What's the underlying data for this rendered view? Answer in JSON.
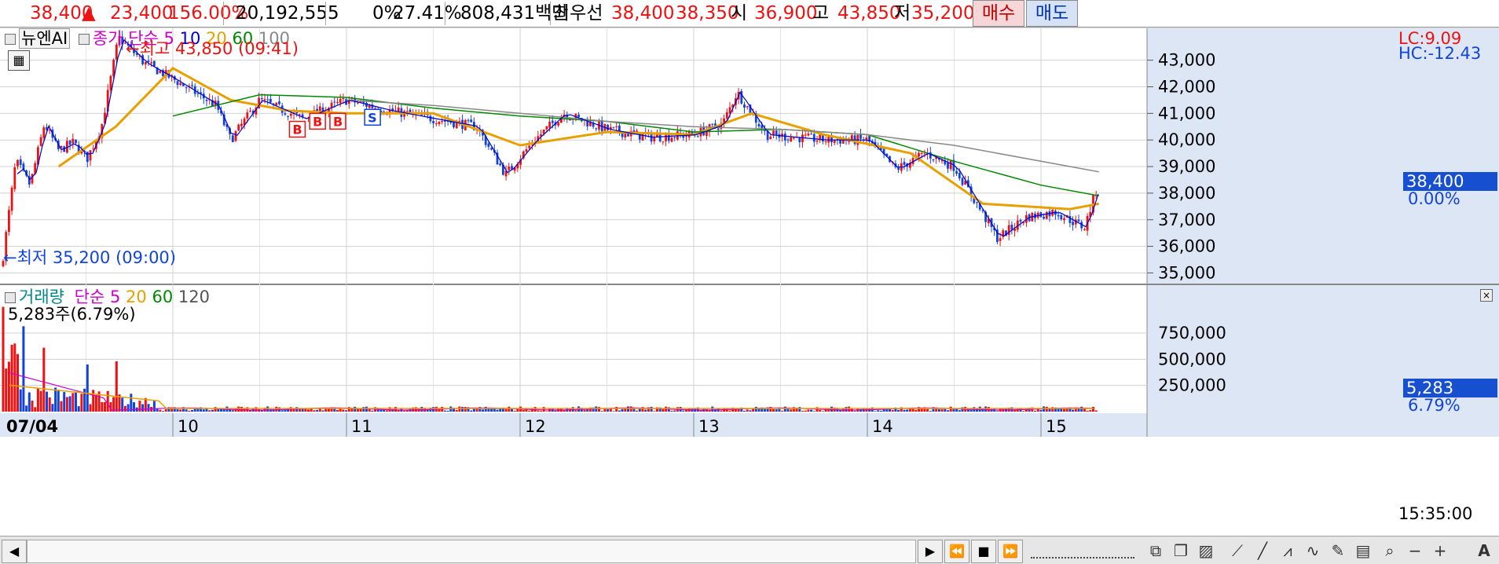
{
  "quote": {
    "price": "38,400",
    "up_arrow": "▲",
    "change": "23,400",
    "change_pct": "156.00%",
    "volume": "20,192,555",
    "zero_pct": "0%",
    "ratio": "27.41%",
    "amount": "808,431백만",
    "best_label": "최우선",
    "best_ask": "38,400",
    "best_bid": "38,350",
    "open_label": "시",
    "open": "36,900",
    "high_label": "고",
    "high": "43,850",
    "low_label": "저",
    "low": "35,200",
    "buy_label": "매수",
    "sell_label": "매도"
  },
  "colors": {
    "up": "#ee1111",
    "down": "#1144dd",
    "ma5": "#0000cc",
    "ma20": "#e8a000",
    "ma60": "#008800",
    "ma100": "#888888",
    "buy_bg": "#f6d6d6",
    "sell_bg": "#d6e2f6",
    "axis_bg": "#dde6f4",
    "grid": "#d0d0d0"
  },
  "price_panel": {
    "stock_name": "뉴엔AI",
    "ma_label": "종가 단순",
    "ma_periods": [
      "5",
      "10",
      "20",
      "60",
      "100"
    ],
    "lc": "LC:9.09",
    "hc": "HC:-12.43",
    "high_note": "최고 43,850 (09:41)",
    "low_note": "최저 35,200 (09:00)",
    "current_price": "38,400",
    "current_pct": "0.00%",
    "signals": [
      "B",
      "B",
      "B",
      "S"
    ]
  },
  "volume_panel": {
    "label": "거래량",
    "ma_label": "단순",
    "ma_periods": [
      "5",
      "20",
      "60",
      "120"
    ],
    "info": "5,283주(6.79%)",
    "current": "5,283",
    "current_pct": "6.79%"
  },
  "time_axis": {
    "labels": [
      "07/04",
      "10",
      "11",
      "12",
      "13",
      "14",
      "15"
    ],
    "current_time": "15:35:00"
  },
  "toolbar_icons": [
    "play-icon",
    "rewind-icon",
    "stop-icon",
    "fast-forward-icon"
  ],
  "chart_data": {
    "type": "candlestick",
    "timeframe": "1-minute intraday, 07/04",
    "price_axis": {
      "ticks": [
        "43,000",
        "42,000",
        "41,000",
        "40,000",
        "39,000",
        "38,000",
        "37,000",
        "36,000",
        "35,000"
      ],
      "ylim": [
        34600,
        44200
      ]
    },
    "volume_axis": {
      "ticks": [
        "750,000",
        "500,000",
        "250,000"
      ],
      "ylim": [
        0,
        1200000
      ]
    },
    "x_sessions": [
      "07/04 09:00",
      "10",
      "11",
      "12",
      "13",
      "14",
      "15"
    ],
    "close_path": [
      {
        "t": "09:00",
        "close": 35200
      },
      {
        "t": "09:05",
        "close": 39200
      },
      {
        "t": "09:10",
        "close": 38300
      },
      {
        "t": "09:15",
        "close": 40600
      },
      {
        "t": "09:20",
        "close": 39600
      },
      {
        "t": "09:25",
        "close": 39900
      },
      {
        "t": "09:30",
        "close": 39300
      },
      {
        "t": "09:35",
        "close": 40500
      },
      {
        "t": "09:41",
        "close": 43850
      },
      {
        "t": "09:50",
        "close": 42900
      },
      {
        "t": "10:00",
        "close": 42300
      },
      {
        "t": "10:15",
        "close": 41300
      },
      {
        "t": "10:20",
        "close": 40000
      },
      {
        "t": "10:30",
        "close": 41500
      },
      {
        "t": "10:45",
        "close": 40800
      },
      {
        "t": "11:00",
        "close": 41500
      },
      {
        "t": "11:15",
        "close": 41100
      },
      {
        "t": "11:30",
        "close": 40800
      },
      {
        "t": "11:45",
        "close": 40500
      },
      {
        "t": "11:55",
        "close": 38700
      },
      {
        "t": "12:05",
        "close": 40000
      },
      {
        "t": "12:15",
        "close": 41000
      },
      {
        "t": "12:30",
        "close": 40400
      },
      {
        "t": "12:45",
        "close": 40100
      },
      {
        "t": "13:00",
        "close": 40200
      },
      {
        "t": "13:10",
        "close": 40600
      },
      {
        "t": "13:15",
        "close": 41800
      },
      {
        "t": "13:25",
        "close": 40200
      },
      {
        "t": "13:45",
        "close": 40000
      },
      {
        "t": "14:00",
        "close": 40000
      },
      {
        "t": "14:10",
        "close": 38900
      },
      {
        "t": "14:20",
        "close": 39500
      },
      {
        "t": "14:30",
        "close": 39000
      },
      {
        "t": "14:45",
        "close": 36300
      },
      {
        "t": "14:55",
        "close": 37100
      },
      {
        "t": "15:05",
        "close": 37300
      },
      {
        "t": "15:15",
        "close": 36700
      },
      {
        "t": "15:20",
        "close": 38400
      }
    ],
    "moving_averages": {
      "ma20": [
        {
          "t": "09:20",
          "v": 39000
        },
        {
          "t": "09:40",
          "v": 40500
        },
        {
          "t": "10:00",
          "v": 42700
        },
        {
          "t": "10:20",
          "v": 41500
        },
        {
          "t": "10:40",
          "v": 41100
        },
        {
          "t": "11:00",
          "v": 41000
        },
        {
          "t": "11:30",
          "v": 41000
        },
        {
          "t": "12:00",
          "v": 39800
        },
        {
          "t": "12:30",
          "v": 40300
        },
        {
          "t": "13:00",
          "v": 40200
        },
        {
          "t": "13:20",
          "v": 41000
        },
        {
          "t": "13:45",
          "v": 40200
        },
        {
          "t": "14:15",
          "v": 39500
        },
        {
          "t": "14:40",
          "v": 37600
        },
        {
          "t": "15:10",
          "v": 37400
        },
        {
          "t": "15:20",
          "v": 37600
        }
      ],
      "ma60": [
        {
          "t": "10:00",
          "v": 40900
        },
        {
          "t": "10:30",
          "v": 41700
        },
        {
          "t": "11:00",
          "v": 41600
        },
        {
          "t": "11:30",
          "v": 41200
        },
        {
          "t": "12:00",
          "v": 40900
        },
        {
          "t": "12:30",
          "v": 40700
        },
        {
          "t": "13:00",
          "v": 40300
        },
        {
          "t": "13:30",
          "v": 40400
        },
        {
          "t": "14:00",
          "v": 40200
        },
        {
          "t": "14:30",
          "v": 39200
        },
        {
          "t": "15:00",
          "v": 38300
        },
        {
          "t": "15:20",
          "v": 37900
        }
      ],
      "ma100": [
        {
          "t": "11:00",
          "v": 41500
        },
        {
          "t": "11:30",
          "v": 41300
        },
        {
          "t": "12:00",
          "v": 41000
        },
        {
          "t": "12:30",
          "v": 40700
        },
        {
          "t": "13:00",
          "v": 40500
        },
        {
          "t": "13:30",
          "v": 40400
        },
        {
          "t": "14:00",
          "v": 40200
        },
        {
          "t": "14:30",
          "v": 39800
        },
        {
          "t": "15:00",
          "v": 39200
        },
        {
          "t": "15:20",
          "v": 38800
        }
      ]
    },
    "volume_spikes": [
      {
        "t": "09:00",
        "v": 1000000
      },
      {
        "t": "09:05",
        "v": 650000
      },
      {
        "t": "09:15",
        "v": 610000
      },
      {
        "t": "09:30",
        "v": 450000
      },
      {
        "t": "09:40",
        "v": 480000
      }
    ],
    "last_volume": 5283
  }
}
